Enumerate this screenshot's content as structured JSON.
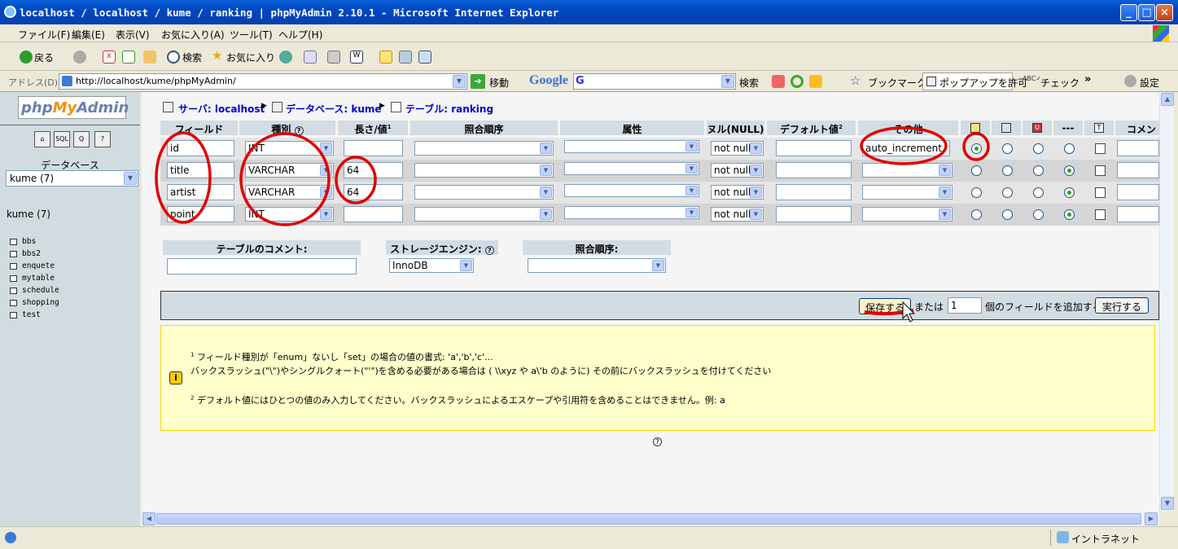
{
  "window": {
    "title": "localhost / localhost / kume / ranking | phpMyAdmin 2.10.1 - Microsoft Internet Explorer"
  },
  "menu": [
    "ファイル(F)",
    "編集(E)",
    "表示(V)",
    "お気に入り(A)",
    "ツール(T)",
    "ヘルプ(H)"
  ],
  "toolbar": {
    "back": "戻る",
    "search": "検索",
    "favorites": "お気に入り"
  },
  "address": {
    "label": "アドレス(D)",
    "url": "http://localhost/kume/phpMyAdmin/",
    "go": "移動"
  },
  "google": {
    "logo": "Google",
    "search": "検索",
    "bookmarks": "ブックマーク",
    "popup": "ポップアップを許可",
    "check": "チェック",
    "settings": "設定"
  },
  "left": {
    "logo_a": "php",
    "logo_b": "My",
    "logo_c": "Admin",
    "db_label": "データベース",
    "db_select": "kume (7)",
    "db_name": "kume (7)",
    "tables": [
      "bbs",
      "bbs2",
      "enquete",
      "mytable",
      "schedule",
      "shopping",
      "test"
    ]
  },
  "breadcrumb": {
    "server": "サーバ: localhost",
    "database": "データベース: kume",
    "table": "テーブル: ranking"
  },
  "columns": {
    "field": "フィールド",
    "type": "種別",
    "length": "長さ/値",
    "collation": "照合順序",
    "attr": "属性",
    "null": "ヌル(NULL)",
    "default": "デフォルト値",
    "extra": "その他",
    "dash": "---",
    "comment": "コメン"
  },
  "rows": [
    {
      "field": "id",
      "type": "INT",
      "length": "",
      "null": "not null",
      "extra": "auto_increment",
      "radio": 0
    },
    {
      "field": "title",
      "type": "VARCHAR",
      "length": "64",
      "null": "not null",
      "extra": "",
      "radio": 3
    },
    {
      "field": "artist",
      "type": "VARCHAR",
      "length": "64",
      "null": "not null",
      "extra": "",
      "radio": 3
    },
    {
      "field": "point",
      "type": "INT",
      "length": "",
      "null": "not null",
      "extra": "",
      "radio": 3
    }
  ],
  "lower": {
    "table_comment": "テーブルのコメント:",
    "storage": "ストレージエンジン:",
    "storage_value": "InnoDB",
    "collation": "照合順序:"
  },
  "savebar": {
    "save": "保存する",
    "or": "または",
    "count": "1",
    "add_fields": "個のフィールドを追加する",
    "go": "実行する"
  },
  "notice": {
    "line1": "フィールド種別が「enum」ないし「set」の場合の値の書式: 'a','b','c'...",
    "line2": "バックスラッシュ(\"\\\")やシングルクォート(\"'\")を含める必要がある場合は ( \\\\xyz や a\\'b のように) その前にバックスラッシュを付けてください",
    "line3": "デフォルト値にはひとつの値のみ入力してください。バックスラッシュによるエスケープや引用符を含めることはできません。例: a"
  },
  "status": {
    "zone": "イントラネット"
  }
}
